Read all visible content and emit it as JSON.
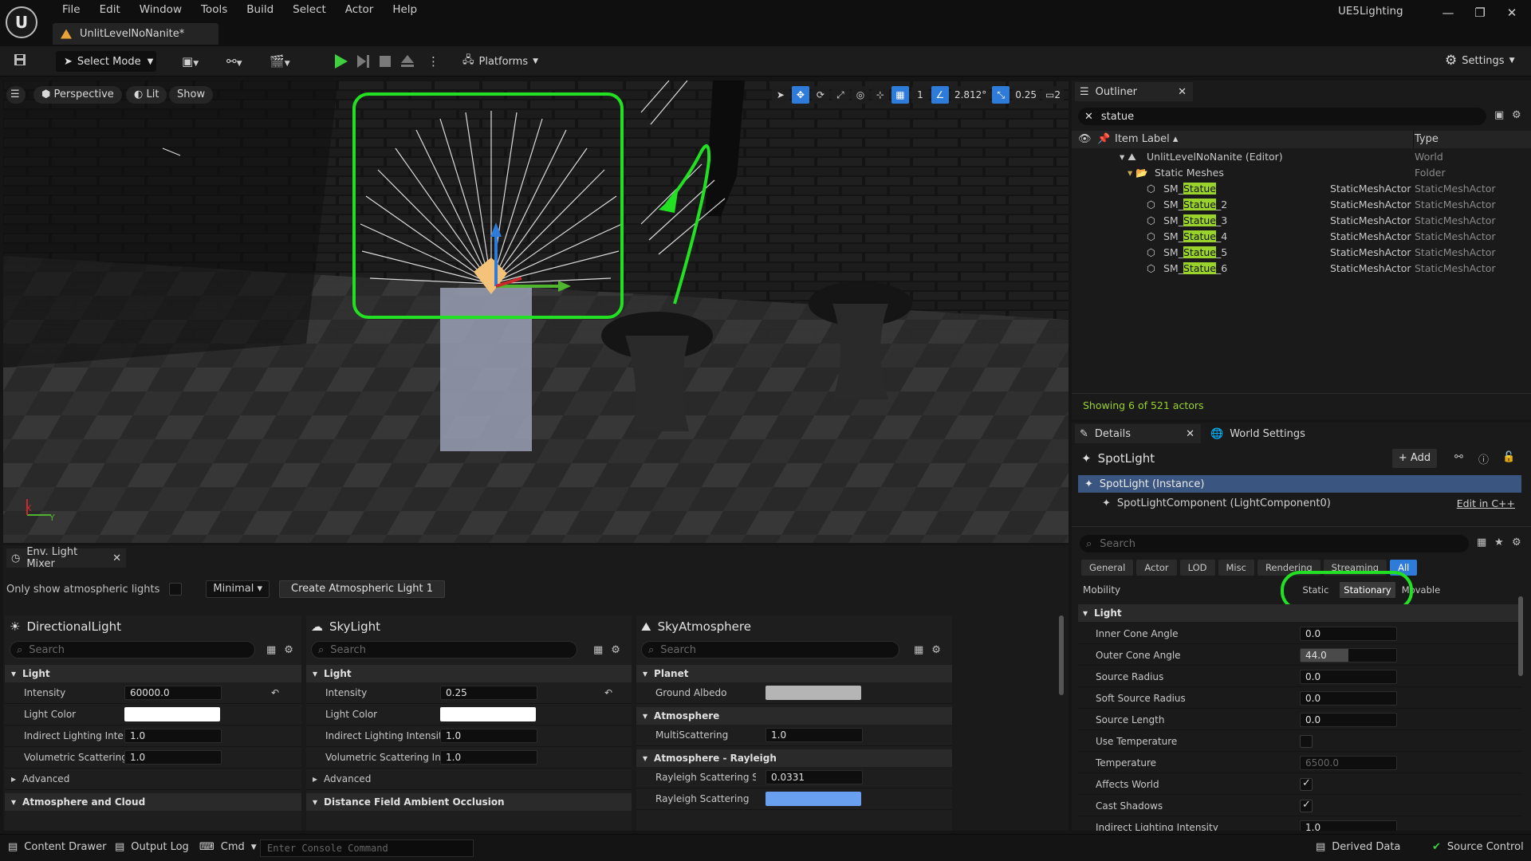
{
  "app": {
    "project_name": "UE5Lighting",
    "logo": "U"
  },
  "menu": [
    "File",
    "Edit",
    "Window",
    "Tools",
    "Build",
    "Select",
    "Actor",
    "Help"
  ],
  "document_tab": "UnlitLevelNoNanite*",
  "toolbar": {
    "select_mode": "Select Mode",
    "platforms": "Platforms",
    "settings": "Settings"
  },
  "viewport": {
    "view_mode": "Perspective",
    "lighting_mode": "Lit",
    "show": "Show",
    "rotation_snap": "2.812°",
    "scale_snap": "0.25",
    "grid_snap": "1",
    "camera_speed": "2",
    "axis_x": "X",
    "axis_y": "Y"
  },
  "env_mixer": {
    "tab": "Env. Light Mixer",
    "only_show_label": "Only show atmospheric lights",
    "display_mode": "Minimal",
    "create_button": "Create Atmospheric Light 1",
    "directional": {
      "title": "DirectionalLight",
      "search": "Search",
      "category": "Light",
      "props": [
        {
          "label": "Intensity",
          "value": "60000.0"
        },
        {
          "label": "Light Color",
          "value": ""
        },
        {
          "label": "Indirect Lighting Inten...",
          "value": "1.0"
        },
        {
          "label": "Volumetric Scattering...",
          "value": "1.0"
        }
      ],
      "advanced": "Advanced",
      "category2": "Atmosphere and Cloud"
    },
    "skylight": {
      "title": "SkyLight",
      "search": "Search",
      "category": "Light",
      "props": [
        {
          "label": "Intensity",
          "value": "0.25"
        },
        {
          "label": "Light Color",
          "value": ""
        },
        {
          "label": "Indirect Lighting Intensity",
          "value": "1.0"
        },
        {
          "label": "Volumetric Scattering In...",
          "value": "1.0"
        }
      ],
      "advanced": "Advanced",
      "category2": "Distance Field Ambient Occlusion"
    },
    "skyatmosphere": {
      "title": "SkyAtmosphere",
      "search": "Search",
      "cat_planet": "Planet",
      "ground_albedo": "Ground Albedo",
      "cat_atmosphere": "Atmosphere",
      "multiscattering_label": "MultiScattering",
      "multiscattering_value": "1.0",
      "cat_rayleigh": "Atmosphere - Rayleigh",
      "rayleigh_scale_label": "Rayleigh Scattering Sca...",
      "rayleigh_scale_value": "0.0331",
      "rayleigh_scattering_label": "Rayleigh Scattering",
      "rayleigh_color": "#6aa0f0"
    }
  },
  "outliner": {
    "tab": "Outliner",
    "search_value": "statue",
    "col_label": "Item Label",
    "col_type": "Type",
    "world": {
      "label": "UnlitLevelNoNanite (Editor)",
      "type": "World"
    },
    "folder": {
      "label": "Static Meshes",
      "type": "Folder"
    },
    "items": [
      {
        "prefix": "SM_",
        "match": "Statue",
        "suffix": "",
        "class": "StaticMeshActor",
        "type": "StaticMeshActor"
      },
      {
        "prefix": "SM_",
        "match": "Statue",
        "suffix": "_2",
        "class": "StaticMeshActor",
        "type": "StaticMeshActor"
      },
      {
        "prefix": "SM_",
        "match": "Statue",
        "suffix": "_3",
        "class": "StaticMeshActor",
        "type": "StaticMeshActor"
      },
      {
        "prefix": "SM_",
        "match": "Statue",
        "suffix": "_4",
        "class": "StaticMeshActor",
        "type": "StaticMeshActor"
      },
      {
        "prefix": "SM_",
        "match": "Statue",
        "suffix": "_5",
        "class": "StaticMeshActor",
        "type": "StaticMeshActor"
      },
      {
        "prefix": "SM_",
        "match": "Statue",
        "suffix": "_6",
        "class": "StaticMeshActor",
        "type": "StaticMeshActor"
      }
    ],
    "footer": "Showing 6 of 521 actors"
  },
  "details": {
    "tab": "Details",
    "world_settings_tab": "World Settings",
    "actor": "SpotLight",
    "add": "Add",
    "instance": "SpotLight (Instance)",
    "component": "SpotLightComponent (LightComponent0)",
    "edit_cpp": "Edit in C++",
    "search": "Search",
    "filters": [
      "General",
      "Actor",
      "LOD",
      "Misc",
      "Rendering",
      "Streaming",
      "All"
    ],
    "active_filter": "All",
    "mobility_label": "Mobility",
    "mobility_options": [
      "Static",
      "Stationary",
      "Movable"
    ],
    "mobility_selected": "Stationary",
    "category": "Light",
    "props": [
      {
        "label": "Inner Cone Angle",
        "value": "0.0"
      },
      {
        "label": "Outer Cone Angle",
        "value": "44.0"
      },
      {
        "label": "Source Radius",
        "value": "0.0"
      },
      {
        "label": "Soft Source Radius",
        "value": "0.0"
      },
      {
        "label": "Source Length",
        "value": "0.0"
      },
      {
        "label": "Use Temperature",
        "value": ""
      },
      {
        "label": "Temperature",
        "value": "6500.0"
      },
      {
        "label": "Affects World",
        "value": ""
      },
      {
        "label": "Cast Shadows",
        "value": ""
      },
      {
        "label": "Indirect Lighting Intensity",
        "value": "1.0"
      }
    ]
  },
  "statusbar": {
    "content_drawer": "Content Drawer",
    "output_log": "Output Log",
    "cmd": "Cmd",
    "console_placeholder": "Enter Console Command",
    "derived_data": "Derived Data",
    "source_control": "Source Control"
  },
  "colors": {
    "accent_blue": "#2f7bd9",
    "highlight_green": "#22e022",
    "search_match": "#9ad32b"
  }
}
